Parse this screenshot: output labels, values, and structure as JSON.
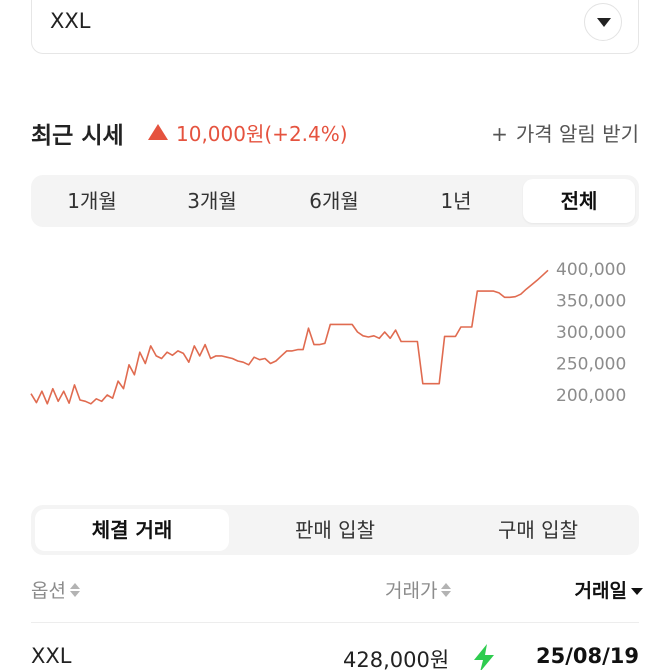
{
  "size_select": {
    "value": "XXL",
    "dropdown_icon": "caret-down-icon"
  },
  "price_header": {
    "title": "최근 시세",
    "change_text": "10,000원(+2.4%)",
    "change_color": "#e5533f",
    "trend_icon": "triangle-up-icon",
    "alert_plus": "+",
    "alert_label": "가격 알림 받기"
  },
  "period_tabs": [
    "1개월",
    "3개월",
    "6개월",
    "1년",
    "전체"
  ],
  "period_active": "전체",
  "chart_data": {
    "type": "line",
    "line_color": "#e06b50",
    "y_ticks": [
      400000,
      350000,
      300000,
      250000,
      200000
    ],
    "y_tick_labels": [
      "400,000",
      "350,000",
      "300,000",
      "250,000",
      "200,000"
    ],
    "ylim": [
      190000,
      410000
    ],
    "grid": false,
    "points": [
      [
        0,
        202000
      ],
      [
        1,
        188000
      ],
      [
        2,
        206000
      ],
      [
        3,
        186000
      ],
      [
        4,
        210000
      ],
      [
        5,
        190000
      ],
      [
        6,
        206000
      ],
      [
        7,
        187000
      ],
      [
        8,
        216000
      ],
      [
        9,
        192000
      ],
      [
        10,
        190000
      ],
      [
        11,
        186000
      ],
      [
        12,
        194000
      ],
      [
        13,
        190000
      ],
      [
        14,
        200000
      ],
      [
        15,
        195000
      ],
      [
        16,
        222000
      ],
      [
        17,
        210000
      ],
      [
        18,
        248000
      ],
      [
        19,
        232000
      ],
      [
        20,
        268000
      ],
      [
        21,
        250000
      ],
      [
        22,
        278000
      ],
      [
        23,
        262000
      ],
      [
        24,
        258000
      ],
      [
        25,
        268000
      ],
      [
        26,
        263000
      ],
      [
        27,
        270000
      ],
      [
        28,
        266000
      ],
      [
        29,
        252000
      ],
      [
        30,
        278000
      ],
      [
        31,
        262000
      ],
      [
        32,
        280000
      ],
      [
        33,
        258000
      ],
      [
        34,
        262000
      ],
      [
        35,
        262000
      ],
      [
        36,
        260000
      ],
      [
        37,
        258000
      ],
      [
        38,
        254000
      ],
      [
        39,
        252000
      ],
      [
        40,
        248000
      ],
      [
        41,
        260000
      ],
      [
        42,
        256000
      ],
      [
        43,
        258000
      ],
      [
        44,
        250000
      ],
      [
        45,
        254000
      ],
      [
        46,
        262000
      ],
      [
        47,
        270000
      ],
      [
        48,
        270000
      ],
      [
        49,
        272000
      ],
      [
        50,
        272000
      ],
      [
        51,
        306000
      ],
      [
        52,
        280000
      ],
      [
        53,
        280000
      ],
      [
        54,
        282000
      ],
      [
        55,
        312000
      ],
      [
        56,
        312000
      ],
      [
        57,
        312000
      ],
      [
        58,
        312000
      ],
      [
        59,
        312000
      ],
      [
        60,
        300000
      ],
      [
        61,
        294000
      ],
      [
        62,
        292000
      ],
      [
        63,
        294000
      ],
      [
        64,
        290000
      ],
      [
        65,
        300000
      ],
      [
        66,
        290000
      ],
      [
        67,
        303000
      ],
      [
        68,
        285000
      ],
      [
        69,
        285000
      ],
      [
        70,
        285000
      ],
      [
        71,
        285000
      ],
      [
        72,
        218000
      ],
      [
        73,
        218000
      ],
      [
        74,
        218000
      ],
      [
        75,
        218000
      ],
      [
        76,
        293000
      ],
      [
        77,
        293000
      ],
      [
        78,
        293000
      ],
      [
        79,
        308000
      ],
      [
        80,
        308000
      ],
      [
        81,
        308000
      ],
      [
        82,
        365000
      ],
      [
        83,
        365000
      ],
      [
        84,
        365000
      ],
      [
        85,
        365000
      ],
      [
        86,
        362000
      ],
      [
        87,
        355000
      ],
      [
        88,
        355000
      ],
      [
        89,
        356000
      ],
      [
        90,
        360000
      ],
      [
        91,
        368000
      ],
      [
        92,
        375000
      ],
      [
        93,
        382000
      ],
      [
        94,
        390000
      ],
      [
        95,
        398000
      ]
    ]
  },
  "trade_tabs": [
    "체결 거래",
    "판매 입찰",
    "구매 입찰"
  ],
  "trade_active": "체결 거래",
  "table": {
    "headers": [
      {
        "label": "옵션",
        "sort": "both"
      },
      {
        "label": "거래가",
        "sort": "both"
      },
      {
        "label": "거래일",
        "sort": "desc"
      }
    ],
    "rows": [
      {
        "option": "XXL",
        "price": "428,000원",
        "fast_icon": "lightning-icon",
        "date": "25/08/19"
      }
    ]
  }
}
